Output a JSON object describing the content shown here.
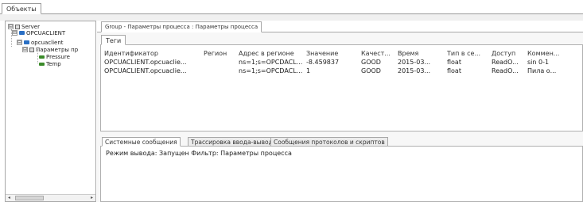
{
  "top_tab": {
    "label": "Объекты"
  },
  "tree": {
    "nodes": [
      {
        "label": "Server",
        "expander": "⊟"
      },
      {
        "label": "OPCUACLIENT",
        "expander": "⊟"
      },
      {
        "label": "opcuaclient",
        "expander": "⊟"
      },
      {
        "label": "Параметры пр",
        "expander": "⊟"
      },
      {
        "label": "Pressure"
      },
      {
        "label": "Temp"
      }
    ],
    "scroll": {
      "left": "◂",
      "right": "▸"
    }
  },
  "main_tab": {
    "label": "Group - Параметры процесса : Параметры процесса"
  },
  "sub_tab": {
    "label": "Теги"
  },
  "table": {
    "columns": [
      "Идентификатор",
      "Регион",
      "Адрес в регионе",
      "Значение",
      "Качест...",
      "Время",
      "Тип в се...",
      "Доступ",
      "Коммен..."
    ],
    "rows": [
      [
        "OPCUACLIENT.opcuaclie...",
        "",
        "ns=1;s=OPCDACL...",
        "-8.459837",
        "GOOD",
        "2015-03...",
        "float",
        "ReadO...",
        "sin 0-1"
      ],
      [
        "OPCUACLIENT.opcuaclie...",
        "",
        "ns=1;s=OPCDACL...",
        "1",
        "GOOD",
        "2015-03...",
        "float",
        "ReadO...",
        "Пила о..."
      ]
    ]
  },
  "log_tabs": [
    "Системные сообщения",
    "Трассировка ввода-вывода",
    "Сообщения протоколов и скриптов"
  ],
  "log": {
    "line": "Режим вывода: Запущен Фильтр: Параметры процесса"
  }
}
